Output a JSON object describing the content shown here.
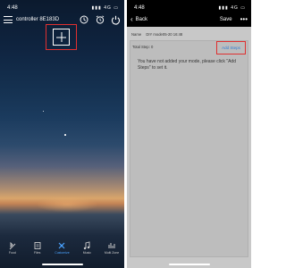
{
  "left": {
    "status": {
      "time": "4:48",
      "network": "4G"
    },
    "header": {
      "title": "controller 8E183D"
    },
    "nav": [
      {
        "key": "food",
        "label": "Food"
      },
      {
        "key": "files",
        "label": "Files"
      },
      {
        "key": "customize",
        "label": "Customize"
      },
      {
        "key": "music",
        "label": "Music"
      },
      {
        "key": "more",
        "label": "Multi Zone"
      }
    ]
  },
  "right": {
    "status": {
      "time": "4:48",
      "network": "4G"
    },
    "header": {
      "back_label": "Back",
      "save_label": "Save",
      "more_label": "•••"
    },
    "name": {
      "label": "Name",
      "value": "DIY mode05-20 16:48"
    },
    "total_step_label": "Total Step: 0",
    "add_steps_label": "Add Steps",
    "empty_message": "You have not added your mode, please click \"Add Steps\" to set it."
  },
  "colors": {
    "accent_red": "#e03030",
    "link_blue": "#2f7fd6",
    "active_nav": "#4aa3ff"
  }
}
